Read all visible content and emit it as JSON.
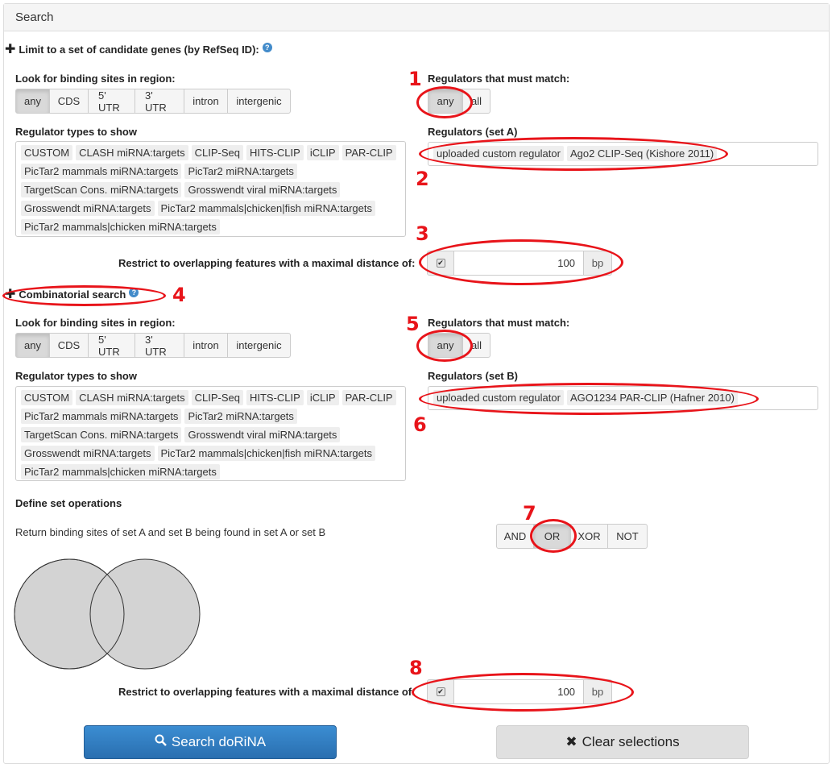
{
  "panel": {
    "title": "Search"
  },
  "limit_section": {
    "label": "Limit to a set of candidate genes (by RefSeq ID):",
    "help": "?"
  },
  "set_a": {
    "region_label": "Look for binding sites in region:",
    "regions": [
      "any",
      "CDS",
      "5' UTR",
      "3' UTR",
      "intron",
      "intergenic"
    ],
    "regions_active": "any",
    "types_label": "Regulator types to show",
    "types": [
      "CUSTOM",
      "CLASH miRNA:targets",
      "CLIP-Seq",
      "HITS-CLIP",
      "iCLIP",
      "PAR-CLIP",
      "PicTar2 mammals miRNA:targets",
      "PicTar2 miRNA:targets",
      "TargetScan Cons. miRNA:targets",
      "Grosswendt viral miRNA:targets",
      "Grosswendt miRNA:targets",
      "PicTar2 mammals|chicken|fish miRNA:targets",
      "PicTar2 mammals|chicken miRNA:targets"
    ],
    "match_label": "Regulators that must match:",
    "match_any": "any",
    "match_all": "all",
    "regulators_label": "Regulators (set A)",
    "regulators": [
      "uploaded custom regulator",
      "Ago2 CLIP-Seq (Kishore 2011)"
    ],
    "distance_label": "Restrict to overlapping features with a maximal distance of:",
    "distance_value": "100",
    "distance_unit": "bp"
  },
  "combinatorial": {
    "label": "Combinatorial search",
    "help": "?"
  },
  "set_b": {
    "region_label": "Look for binding sites in region:",
    "regions": [
      "any",
      "CDS",
      "5' UTR",
      "3' UTR",
      "intron",
      "intergenic"
    ],
    "types_label": "Regulator types to show",
    "types": [
      "CUSTOM",
      "CLASH miRNA:targets",
      "CLIP-Seq",
      "HITS-CLIP",
      "iCLIP",
      "PAR-CLIP",
      "PicTar2 mammals miRNA:targets",
      "PicTar2 miRNA:targets",
      "TargetScan Cons. miRNA:targets",
      "Grosswendt viral miRNA:targets",
      "Grosswendt miRNA:targets",
      "PicTar2 mammals|chicken|fish miRNA:targets",
      "PicTar2 mammals|chicken miRNA:targets"
    ],
    "match_label": "Regulators that must match:",
    "match_any": "any",
    "match_all": "all",
    "regulators_label": "Regulators (set B)",
    "regulators": [
      "uploaded custom regulator",
      "AGO1234 PAR-CLIP (Hafner 2010)"
    ]
  },
  "set_ops": {
    "label": "Define set operations",
    "description": "Return binding sites of set A and set B being found in set A or set B",
    "ops": [
      "AND",
      "OR",
      "XOR",
      "NOT"
    ],
    "active": "OR",
    "distance_label": "Restrict to overlapping features with a maximal distance of:",
    "distance_value": "100",
    "distance_unit": "bp"
  },
  "actions": {
    "search": "Search doRiNA",
    "clear": "Clear selections"
  },
  "annotations": [
    "1",
    "2",
    "3",
    "4",
    "5",
    "6",
    "7",
    "8"
  ],
  "colors": {
    "annotation": "#e8141a",
    "primary": "#2f7dc1",
    "venn_fill": "#d3d3d3"
  }
}
